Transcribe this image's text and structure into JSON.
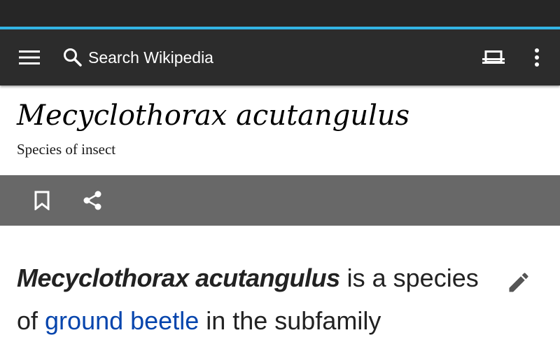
{
  "toolbar": {
    "search_placeholder": "Search Wikipedia",
    "icons": [
      "menu-icon",
      "search-icon",
      "tabs-icon",
      "overflow-menu-icon"
    ]
  },
  "article": {
    "title": "Mecyclothorax acutangulus",
    "description": "Species of insect",
    "actions": [
      "bookmark-icon",
      "share-icon"
    ],
    "lead": {
      "term": "Mecyclothorax acutangulus",
      "text_1": " is a species of ",
      "link_text": "ground beetle",
      "text_2": " in the subfamily"
    }
  },
  "colors": {
    "status_bar": "#262626",
    "accent": "#33b5e5",
    "toolbar": "#2c2c2c",
    "action_bar": "#686868",
    "link": "#0645ad"
  }
}
